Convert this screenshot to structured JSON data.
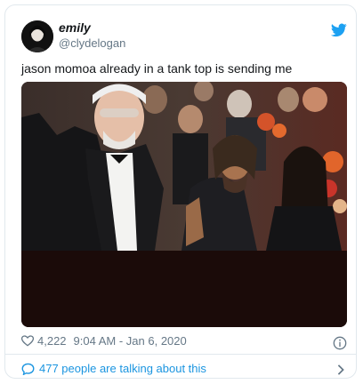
{
  "user": {
    "display_name": "emily",
    "handle": "@clydelogan"
  },
  "tweet": {
    "text": "jason momoa already in a tank top is sending me"
  },
  "stats": {
    "likes": "4,222",
    "timestamp": "9:04 AM - Jan 6, 2020"
  },
  "footer": {
    "conversation": "477 people are talking about this"
  },
  "icons": {
    "brand": "twitter-bird-icon",
    "like": "heart-icon",
    "info": "info-icon",
    "chat": "speech-bubble-icon",
    "more": "chevron-right-icon"
  },
  "colors": {
    "brand": "#1da1f2",
    "link": "#1b95e0",
    "muted": "#657786"
  }
}
